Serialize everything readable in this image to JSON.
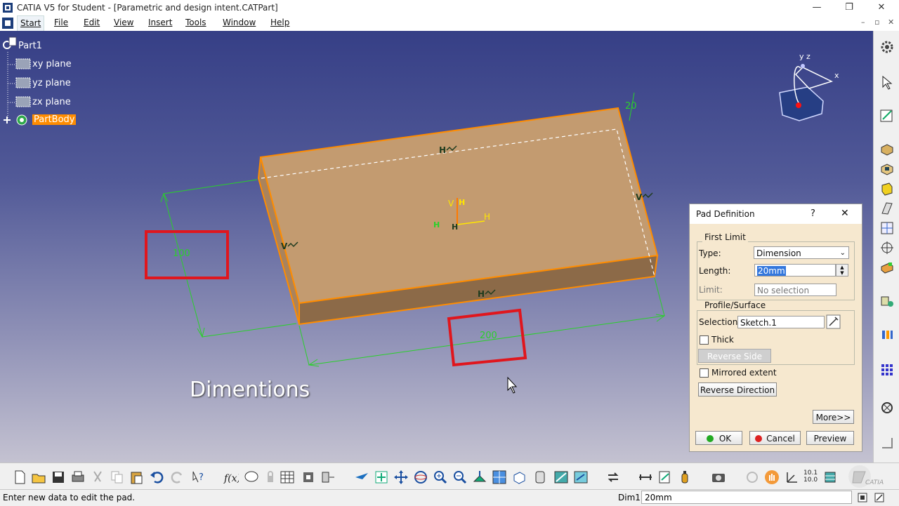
{
  "window": {
    "title": "CATIA V5 for Student - [Parametric and design intent.CATPart]",
    "controls": [
      "—",
      "❐",
      "✕"
    ]
  },
  "menu": {
    "items": [
      "Start",
      "File",
      "Edit",
      "View",
      "Insert",
      "Tools",
      "Window",
      "Help"
    ],
    "doc_controls": [
      "–",
      "▫",
      "✕"
    ]
  },
  "tree": {
    "root": "Part1",
    "planes": [
      "xy plane",
      "yz plane",
      "zx plane"
    ],
    "body": "PartBody"
  },
  "dimensions": {
    "width": "100",
    "length": "200",
    "height": "20"
  },
  "constraint_labels": {
    "horizontal": "H",
    "vertical": "V",
    "cross": "H",
    "axis_v": "V",
    "axis_h": "H"
  },
  "axis_compass": {
    "y": "y",
    "z": "z",
    "x": "x"
  },
  "annotation": "Dimentions",
  "pad_dialog": {
    "title": "Pad Definition",
    "help": "?",
    "close": "✕",
    "first_limit": {
      "label": "First Limit",
      "type_label": "Type:",
      "type_value": "Dimension",
      "length_label": "Length:",
      "length_value": "20mm",
      "limit_label": "Limit:",
      "limit_value": "No selection"
    },
    "profile": {
      "label": "Profile/Surface",
      "selection_label": "Selection:",
      "selection_value": "Sketch.1",
      "thick_label": "Thick",
      "thick_checked": false,
      "reverse_side": "Reverse Side"
    },
    "mirrored_extent": "Mirrored extent",
    "mirrored_checked": false,
    "reverse_direction": "Reverse Direction",
    "more": "More>>",
    "ok": "OK",
    "cancel": "Cancel",
    "preview": "Preview"
  },
  "status": {
    "message": "Enter new data to edit the pad.",
    "dim_label": "Dim1",
    "dim_value": "20mm"
  },
  "colors": {
    "viewport_top": "#363f86",
    "part_face": "#c39b70",
    "part_edge": "#ff8c00",
    "dimension": "#2ad02a",
    "highlight_box": "#e0161d",
    "selected_node": "#ff8c00",
    "dialog_bg": "#f6e8cf"
  },
  "zoom_readout": "10.1\n10.0"
}
